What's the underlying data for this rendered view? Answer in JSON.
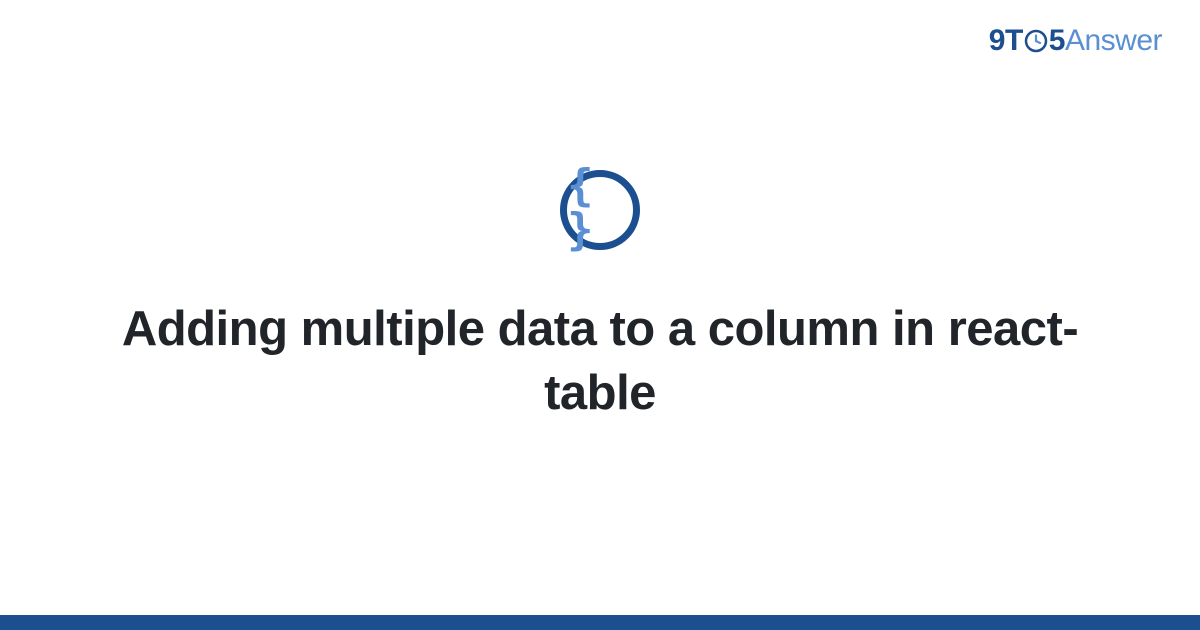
{
  "logo": {
    "nine": "9",
    "t": "T",
    "five": "5",
    "answer": "Answer"
  },
  "icon": {
    "name": "braces-icon",
    "glyph": "{ }"
  },
  "title": "Adding multiple data to a column in react-table",
  "colors": {
    "primary": "#1b4f8f",
    "accent": "#5a8fd4"
  }
}
